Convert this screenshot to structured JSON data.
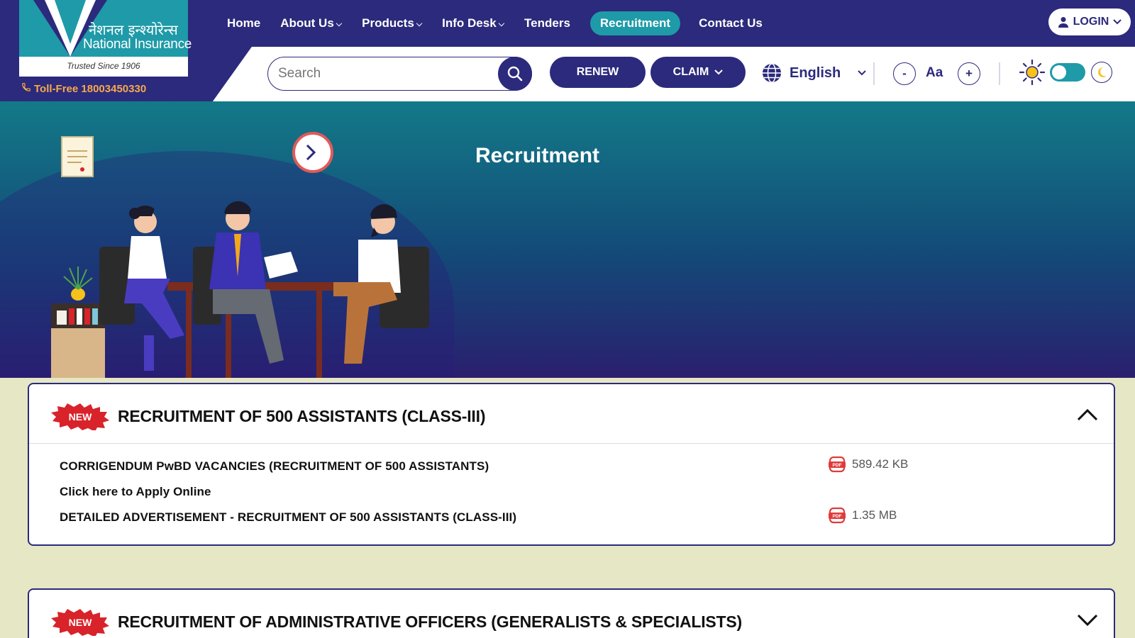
{
  "brand": {
    "hindi_name": "नेशनल इन्श्योरेन्स",
    "english_name": "National Insurance",
    "tagline": "Trusted Since 1906",
    "tollfree": "Toll-Free 18003450330"
  },
  "nav": {
    "items": [
      {
        "label": "Home"
      },
      {
        "label": "About Us"
      },
      {
        "label": "Products"
      },
      {
        "label": "Info Desk"
      },
      {
        "label": "Tenders"
      },
      {
        "label": "Recruitment"
      },
      {
        "label": "Contact Us"
      }
    ],
    "login_label": "LOGIN"
  },
  "search": {
    "placeholder": "Search"
  },
  "actions": {
    "renew_label": "RENEW",
    "claim_label": "CLAIM"
  },
  "language": {
    "selected": "English"
  },
  "font_controls": {
    "decrease": "-",
    "label": "Aa",
    "increase": "+"
  },
  "theme": {
    "mode": "light",
    "accent": "#1f9aa8"
  },
  "banner": {
    "title": "Recruitment"
  },
  "accordions": [
    {
      "badge": "NEW",
      "title": "RECRUITMENT OF 500 ASSISTANTS (CLASS-III)",
      "expanded": true,
      "rows": [
        {
          "label": "CORRIGENDUM PwBD VACANCIES (RECRUITMENT OF 500 ASSISTANTS)",
          "size": "589.42 KB",
          "icon": "pdf-icon"
        },
        {
          "label": "Click here to Apply Online",
          "size": "",
          "icon": ""
        },
        {
          "label": "DETAILED ADVERTISEMENT - RECRUITMENT OF 500 ASSISTANTS (CLASS-III)",
          "size": "1.35 MB",
          "icon": "pdf-icon"
        }
      ]
    },
    {
      "badge": "NEW",
      "title": "RECRUITMENT OF ADMINISTRATIVE OFFICERS (GENERALISTS & SPECIALISTS)",
      "expanded": false,
      "rows": []
    }
  ],
  "colors": {
    "primary": "#2c2a7c",
    "teal": "#1f9aa8",
    "badge_red": "#d8232a",
    "pdf_red": "#e03b3b",
    "page_bg": "#e6e7c4"
  }
}
